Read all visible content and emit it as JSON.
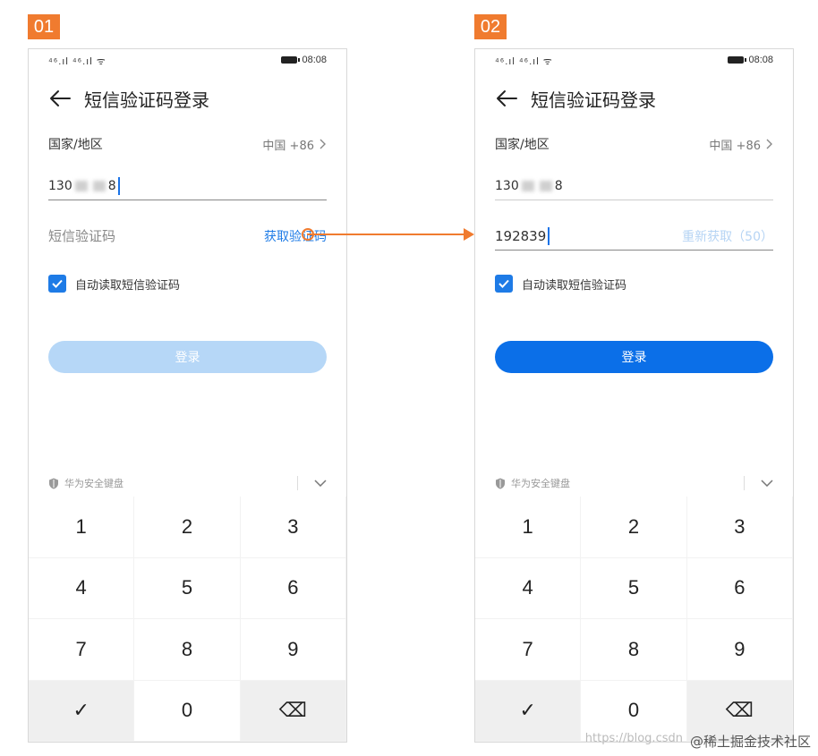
{
  "steps": [
    {
      "badge": "01",
      "status": {
        "signal": "⁴⁶.ıl ⁴⁶.ıl ᯤ",
        "time": "08:08"
      },
      "title": "短信验证码登录",
      "country": {
        "label": "国家/地区",
        "value": "中国 +86"
      },
      "phone": {
        "prefix": "130",
        "suffix": "8"
      },
      "sms": {
        "placeholder": "短信验证码",
        "value": "",
        "link": "获取验证码"
      },
      "auto_read": "自动读取短信验证码",
      "login": "登录",
      "keyboard": {
        "brand": "华为安全键盘",
        "keys": [
          "1",
          "2",
          "3",
          "4",
          "5",
          "6",
          "7",
          "8",
          "9",
          "✓",
          "0",
          "⌫"
        ]
      }
    },
    {
      "badge": "02",
      "status": {
        "signal": "⁴⁶.ıl ⁴⁶.ıl ᯤ",
        "time": "08:08"
      },
      "title": "短信验证码登录",
      "country": {
        "label": "国家/地区",
        "value": "中国 +86"
      },
      "phone": {
        "prefix": "130",
        "suffix": "8"
      },
      "sms": {
        "placeholder": "短信验证码",
        "value": "192839",
        "link": "重新获取（50）"
      },
      "auto_read": "自动读取短信验证码",
      "login": "登录",
      "keyboard": {
        "brand": "华为安全键盘",
        "keys": [
          "1",
          "2",
          "3",
          "4",
          "5",
          "6",
          "7",
          "8",
          "9",
          "✓",
          "0",
          "⌫"
        ]
      }
    }
  ],
  "watermark": {
    "url": "https://blog.csdn",
    "brand": "@稀土掘金技术社区"
  },
  "colors": {
    "accent": "#1e7be6",
    "login_enabled": "#0b6fe8",
    "login_disabled": "#b6d7f7",
    "badge": "#f07b2f"
  }
}
